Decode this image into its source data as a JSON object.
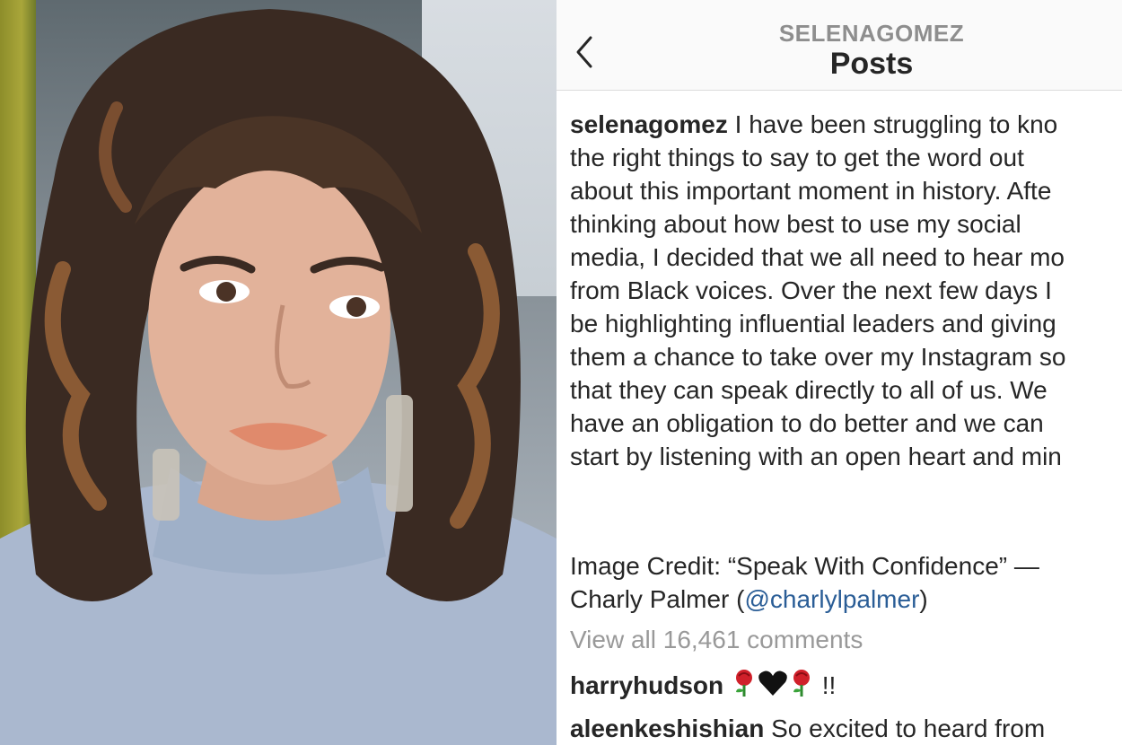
{
  "header": {
    "username": "SELENAGOMEZ",
    "title": "Posts"
  },
  "post": {
    "username": "selenagomez",
    "caption_lines": [
      " I have been struggling to kno",
      "the right things to say to get the word out",
      "about this important moment in history. Afte",
      "thinking about how best to use my social",
      "media, I decided that we all need to hear mo",
      "from Black voices. Over the next few days I",
      "be highlighting influential leaders and giving",
      "them a chance to take over my Instagram so",
      "that they can speak directly to all of us. We",
      "have an obligation to do better and we can",
      "start by listening with an open heart and min"
    ],
    "credit_prefix": "Image Credit: “Speak With Confidence” —",
    "credit_name": "Charly Palmer (",
    "credit_mention": "@charlylpalmer",
    "credit_suffix": ")"
  },
  "comments": {
    "view_all": "View all 16,461 comments",
    "items": [
      {
        "user": "harryhudson",
        "text": "!!",
        "emojis": [
          "rose",
          "black-heart",
          "rose"
        ]
      },
      {
        "user": "aleenkeshishian",
        "text": " So excited to heard from"
      }
    ]
  },
  "colors": {
    "text": "#262626",
    "muted": "#999999",
    "mention": "#2a5d96",
    "header_user": "#8e8e8e"
  }
}
